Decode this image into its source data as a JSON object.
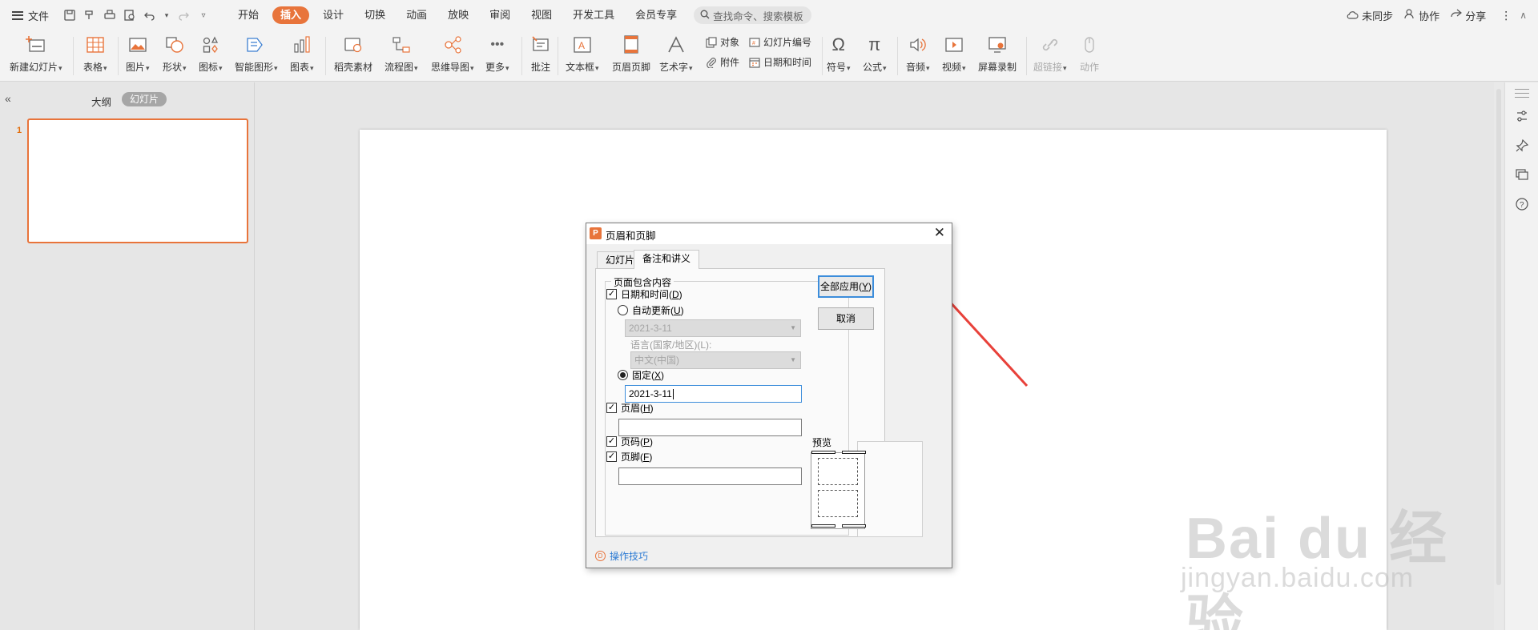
{
  "menubar": {
    "file_label": "文件",
    "tabs": [
      "开始",
      "插入",
      "设计",
      "切换",
      "动画",
      "放映",
      "审阅",
      "视图",
      "开发工具",
      "会员专享"
    ],
    "active_tab": "插入",
    "search_placeholder": "查找命令、搜索模板",
    "right": {
      "sync": "未同步",
      "collab": "协作",
      "share": "分享"
    }
  },
  "ribbon": {
    "new_slide": "新建幻灯片",
    "table": "表格",
    "picture": "图片",
    "shape": "形状",
    "icon": "图标",
    "smart_art": "智能图形",
    "chart": "图表",
    "material": "稻壳素材",
    "flowchart": "流程图",
    "mindmap": "思维导图",
    "more": "更多",
    "comment": "批注",
    "textbox": "文本框",
    "header_footer": "页眉页脚",
    "word_art": "艺术字",
    "object": "对象",
    "attachment": "附件",
    "slide_number": "幻灯片编号",
    "date_time": "日期和时间",
    "symbol": "符号",
    "formula": "公式",
    "audio": "音频",
    "video": "视频",
    "screen_record": "屏幕录制",
    "hyperlink": "超链接",
    "action": "动作"
  },
  "left_panel": {
    "outline_tab": "大纲",
    "slides_tab": "幻灯片",
    "slide_number": "1"
  },
  "dialog": {
    "title": "页眉和页脚",
    "tabs": [
      "幻灯片",
      "备注和讲义"
    ],
    "group_label": "页面包含内容",
    "date_time_label": "日期和时间(",
    "date_time_key": "D",
    "auto_update_label": "自动更新(",
    "auto_update_key": "U",
    "auto_date_value": "2021-3-11",
    "language_label": "语言(国家/地区)(L):",
    "language_value": "中文(中国)",
    "fixed_label": "固定(",
    "fixed_key": "X",
    "fixed_value": "2021-3-11",
    "header_label": "页眉(",
    "header_key": "H",
    "header_value": "",
    "page_number_label": "页码(",
    "page_number_key": "P",
    "footer_label": "页脚(",
    "footer_key": "F",
    "footer_value": "",
    "apply_all_label": "全部应用(",
    "apply_all_key": "Y",
    "cancel_label": "取消",
    "preview_label": "预览",
    "help_link": "操作技巧",
    "checked": {
      "date_time": true,
      "header": true,
      "page_number": true,
      "footer": true
    },
    "date_mode": "fixed"
  },
  "watermark": {
    "big": "Bai du 经验",
    "small": "jingyan.baidu.com"
  },
  "colors": {
    "accent": "#e8743b",
    "focus": "#3c8ddb",
    "link": "#2d7bd3",
    "arrow": "#e8413a"
  }
}
